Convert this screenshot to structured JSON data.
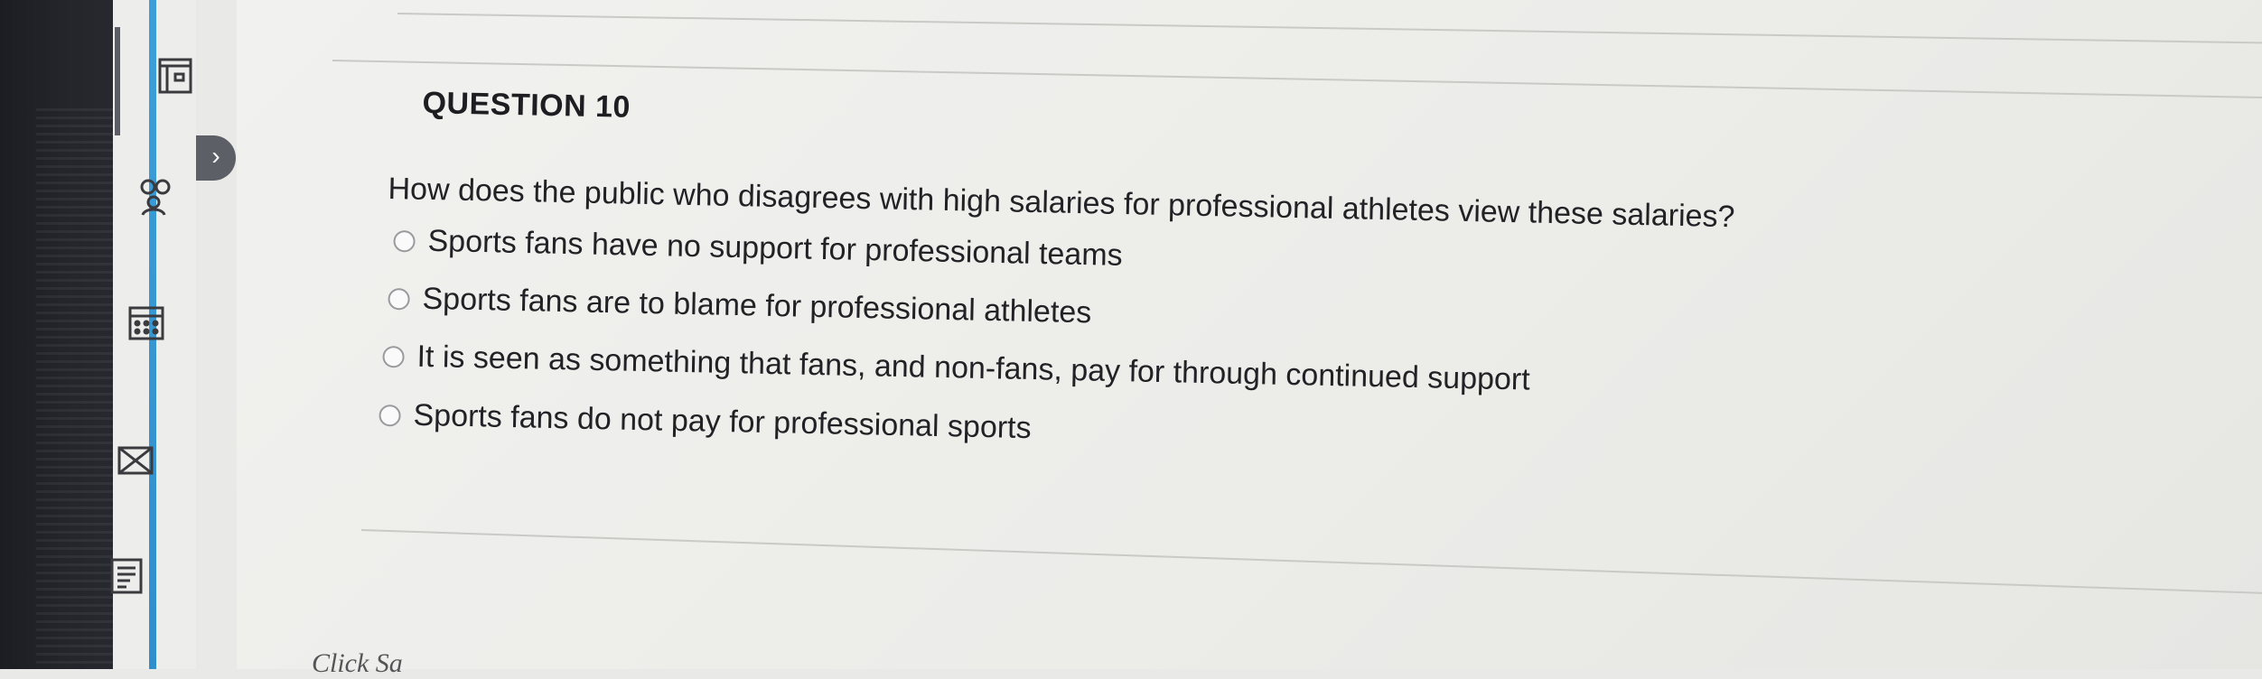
{
  "question": {
    "header": "QUESTION 10",
    "text": "How does the public who disagrees with high salaries for professional athletes view these salaries?",
    "options": [
      {
        "label": "Sports fans have no support for professional teams",
        "selected": false
      },
      {
        "label": "Sports fans are to blame for professional athletes",
        "selected": false
      },
      {
        "label": "It is seen as something that fans, and non-fans, pay for through continued support",
        "selected": false
      },
      {
        "label": "Sports fans do not pay for professional sports",
        "selected": false
      }
    ]
  },
  "sidebar": {
    "icons": [
      "content-icon",
      "people-icon",
      "calendar-icon",
      "mail-icon",
      "notes-icon"
    ],
    "expand_glyph": "›",
    "accent_color": "#3d9fd9"
  },
  "footer": {
    "partial_text": "Click Sa"
  }
}
